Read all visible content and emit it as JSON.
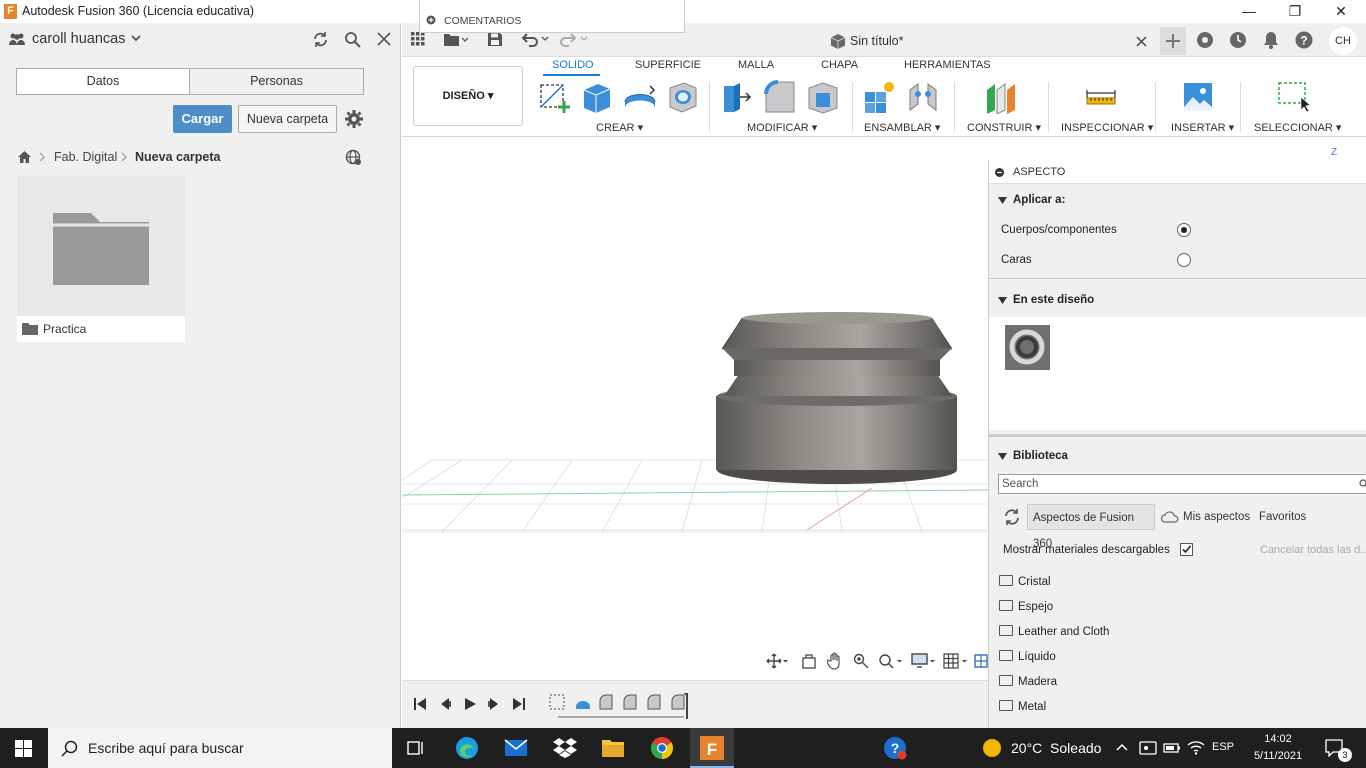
{
  "window": {
    "title": "Autodesk Fusion 360 (Licencia educativa)",
    "logo_letter": "F",
    "minimize": "—",
    "maximize": "❐",
    "close": "✕"
  },
  "data_panel": {
    "user": "caroll huancas",
    "tabs": [
      "Datos",
      "Personas"
    ],
    "upload_label": "Cargar",
    "new_folder_label": "Nueva carpeta",
    "breadcrumb": [
      "Fab. Digital",
      "Nueva carpeta"
    ],
    "folders": [
      {
        "name": "Practica"
      }
    ]
  },
  "top_dropdown": {
    "item": "COMENTARIOS"
  },
  "document": {
    "title": "Sin título*",
    "avatar_initials": "CH"
  },
  "ribbon": {
    "workspace": "DISEÑO",
    "tabs": [
      "SOLIDO",
      "SUPERFICIE",
      "MALLA",
      "CHAPA",
      "HERRAMIENTAS"
    ],
    "active_tab": "SOLIDO",
    "groups": [
      "CREAR",
      "MODIFICAR",
      "ENSAMBLAR",
      "CONSTRUIR",
      "INSPECCIONAR",
      "INSERTAR",
      "SELECCIONAR"
    ]
  },
  "viewport": {
    "axis_label": "Z"
  },
  "appearance_panel": {
    "title": "ASPECTO",
    "apply_to_heading": "Aplicar a:",
    "apply_options": [
      {
        "label": "Cuerpos/componentes",
        "selected": true
      },
      {
        "label": "Caras",
        "selected": false
      }
    ],
    "in_design_heading": "En este diseño",
    "library_heading": "Biblioteca",
    "search_placeholder": "Search",
    "library_tabs": [
      "Aspectos de Fusion 360",
      "Mis aspectos",
      "Favoritos"
    ],
    "show_downloadable_label": "Mostrar materiales descargables",
    "show_downloadable_checked": true,
    "cancel_all_label": "Cancelar todas las d...",
    "categories": [
      "Cristal",
      "Espejo",
      "Leather and Cloth",
      "Líquido",
      "Madera",
      "Metal"
    ]
  },
  "taskbar": {
    "search_placeholder": "Escribe aquí para buscar",
    "weather": "20°C  Soleado",
    "language": "ESP",
    "time": "14:02",
    "date": "5/11/2021",
    "notifications": "3"
  },
  "colors": {
    "accent": "#1a7ad4",
    "upload_button": "#4d8ec9",
    "fusion_orange": "#e8832b",
    "taskbar": "#1f1f1f"
  }
}
